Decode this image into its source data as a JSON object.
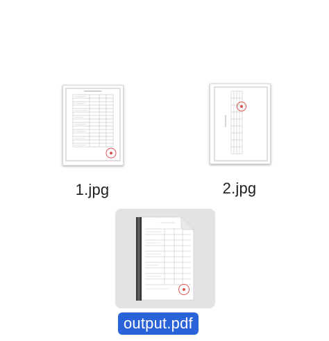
{
  "files": [
    {
      "name": "1.jpg",
      "icon": "image-thumbnail-icon",
      "selected": false
    },
    {
      "name": "2.jpg",
      "icon": "image-thumbnail-icon",
      "selected": false
    },
    {
      "name": "output.pdf",
      "icon": "pdf-document-icon",
      "selected": true
    }
  ],
  "colors": {
    "selection_label": "#2a63d8",
    "selection_box": "#e3e3e3",
    "stamp": "#d9534f"
  }
}
